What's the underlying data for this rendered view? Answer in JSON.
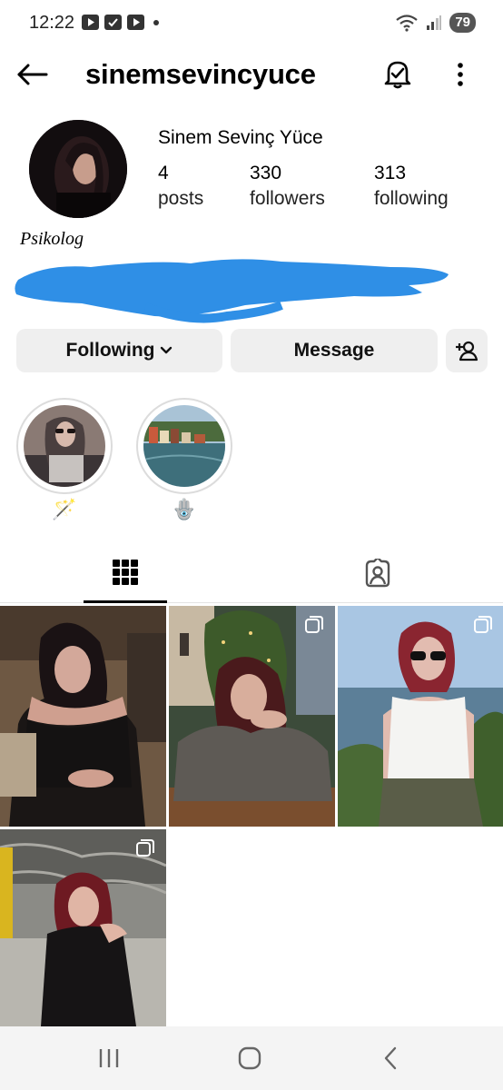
{
  "status_bar": {
    "time": "12:22",
    "battery": "79",
    "icons": [
      "youtube-icon",
      "checkbox-icon",
      "youtube-icon",
      "dot-icon",
      "wifi-icon",
      "signal-icon",
      "battery-icon"
    ]
  },
  "header": {
    "username": "sinemsevincyuce",
    "icons": [
      "back-arrow-icon",
      "bell-check-icon",
      "more-vertical-icon"
    ]
  },
  "profile": {
    "display_name": "Sinem Sevinç Yüce",
    "stats": [
      {
        "value": "4",
        "label": "posts"
      },
      {
        "value": "330",
        "label": "followers"
      },
      {
        "value": "313",
        "label": "following"
      }
    ],
    "bio": "Psikolog"
  },
  "buttons": {
    "following": "Following",
    "message": "Message"
  },
  "highlights": [
    {
      "label": "🪄"
    },
    {
      "label": "🪬"
    }
  ],
  "colors": {
    "redaction": "#2f8fe6",
    "button_bg": "#efefef",
    "text": "#000000"
  }
}
